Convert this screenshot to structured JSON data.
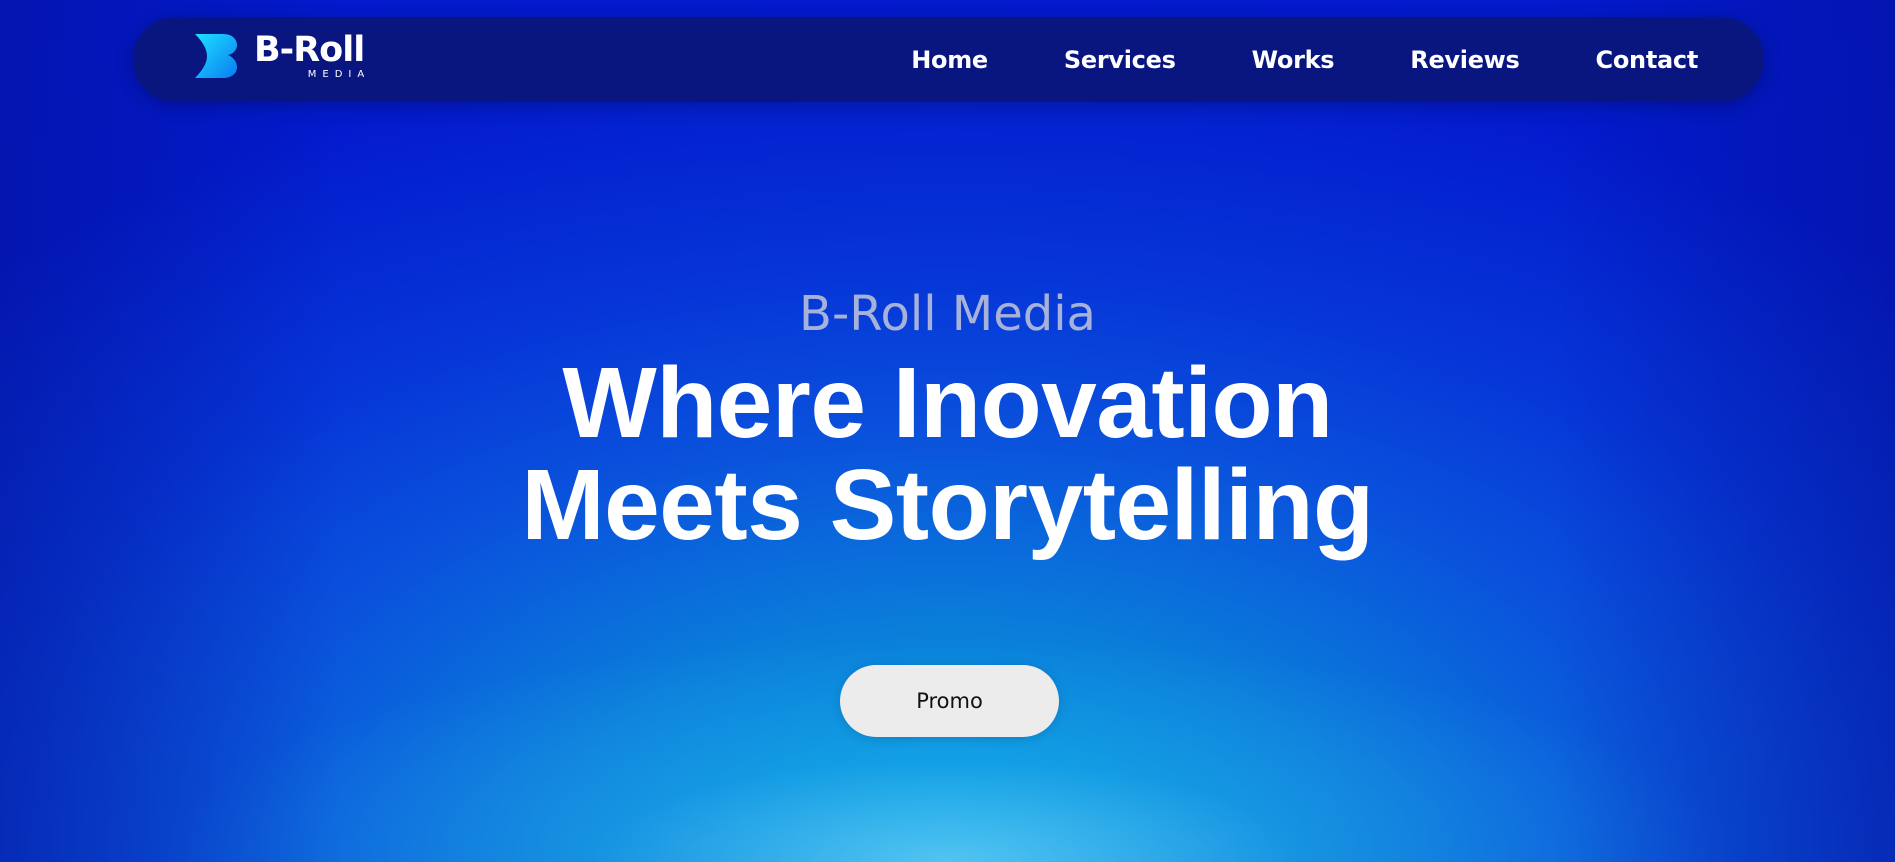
{
  "brand": {
    "name": "B-Roll",
    "subtitle": "MEDIA",
    "logo_icon": "b-roll-logo-mark",
    "gradient_colors": [
      "#1de3ff",
      "#0a7bf2"
    ]
  },
  "nav": {
    "items": [
      {
        "label": "Home"
      },
      {
        "label": "Services"
      },
      {
        "label": "Works"
      },
      {
        "label": "Reviews"
      },
      {
        "label": "Contact"
      }
    ]
  },
  "hero": {
    "kicker": "B-Roll Media",
    "title_line1": "Where Inovation",
    "title_line2": "Meets Storytelling",
    "cta_label": "Promo"
  },
  "colors": {
    "navbar_bg": "#0a1680",
    "background_top": "#0716d0",
    "background_glow": "#00a6e2",
    "button_bg": "#ececec"
  }
}
